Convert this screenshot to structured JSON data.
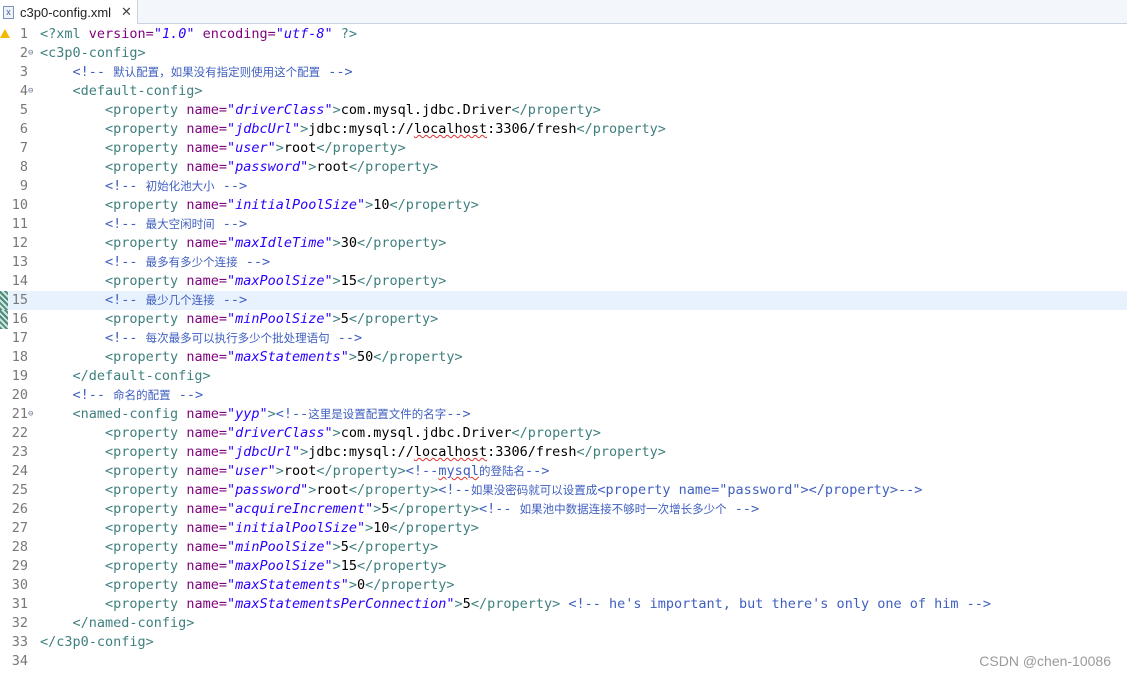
{
  "tab": {
    "title": "c3p0-config.xml",
    "close": "✕",
    "icon": "x"
  },
  "watermark": "CSDN @chen-10086",
  "lines": [
    {
      "n": "1",
      "warn": true,
      "segs": [
        [
          "t",
          "<?xml "
        ],
        [
          "a",
          "version="
        ],
        [
          "v",
          "\"1.0\""
        ],
        [
          "a",
          " encoding="
        ],
        [
          "v",
          "\"utf-8\""
        ],
        [
          "t",
          " ?>"
        ]
      ]
    },
    {
      "n": "2",
      "fold": true,
      "segs": [
        [
          "t",
          "<c3p0-config>"
        ]
      ]
    },
    {
      "n": "3",
      "segs": [
        [
          "x",
          "    "
        ],
        [
          "c",
          "<!-- "
        ],
        [
          "cj",
          "默认配置，如果没有指定则使用这个配置"
        ],
        [
          "c",
          " -->"
        ]
      ]
    },
    {
      "n": "4",
      "fold": true,
      "segs": [
        [
          "x",
          "    "
        ],
        [
          "t",
          "<default-config>"
        ]
      ]
    },
    {
      "n": "5",
      "segs": [
        [
          "x",
          "        "
        ],
        [
          "t",
          "<property "
        ],
        [
          "a",
          "name="
        ],
        [
          "v",
          "\"driverClass\""
        ],
        [
          "t",
          ">"
        ],
        [
          "x",
          "com.mysql.jdbc.Driver"
        ],
        [
          "t",
          "</property>"
        ]
      ]
    },
    {
      "n": "6",
      "segs": [
        [
          "x",
          "        "
        ],
        [
          "t",
          "<property "
        ],
        [
          "a",
          "name="
        ],
        [
          "v",
          "\"jdbcUrl\""
        ],
        [
          "t",
          ">"
        ],
        [
          "x",
          "jdbc:mysql://"
        ],
        [
          "xu",
          "localhost"
        ],
        [
          "x",
          ":3306/fresh"
        ],
        [
          "t",
          "</property>"
        ]
      ]
    },
    {
      "n": "7",
      "segs": [
        [
          "x",
          "        "
        ],
        [
          "t",
          "<property "
        ],
        [
          "a",
          "name="
        ],
        [
          "v",
          "\"user\""
        ],
        [
          "t",
          ">"
        ],
        [
          "x",
          "root"
        ],
        [
          "t",
          "</property>"
        ]
      ]
    },
    {
      "n": "8",
      "segs": [
        [
          "x",
          "        "
        ],
        [
          "t",
          "<property "
        ],
        [
          "a",
          "name="
        ],
        [
          "v",
          "\"password\""
        ],
        [
          "t",
          ">"
        ],
        [
          "x",
          "root"
        ],
        [
          "t",
          "</property>"
        ]
      ]
    },
    {
      "n": "9",
      "segs": [
        [
          "x",
          "        "
        ],
        [
          "c",
          "<!-- "
        ],
        [
          "cj",
          "初始化池大小"
        ],
        [
          "c",
          " -->"
        ]
      ]
    },
    {
      "n": "10",
      "segs": [
        [
          "x",
          "        "
        ],
        [
          "t",
          "<property "
        ],
        [
          "a",
          "name="
        ],
        [
          "v",
          "\"initialPoolSize\""
        ],
        [
          "t",
          ">"
        ],
        [
          "x",
          "10"
        ],
        [
          "t",
          "</property>"
        ]
      ]
    },
    {
      "n": "11",
      "segs": [
        [
          "x",
          "        "
        ],
        [
          "c",
          "<!-- "
        ],
        [
          "cj",
          "最大空闲时间"
        ],
        [
          "c",
          " -->"
        ]
      ]
    },
    {
      "n": "12",
      "segs": [
        [
          "x",
          "        "
        ],
        [
          "t",
          "<property "
        ],
        [
          "a",
          "name="
        ],
        [
          "v",
          "\"maxIdleTime\""
        ],
        [
          "t",
          ">"
        ],
        [
          "x",
          "30"
        ],
        [
          "t",
          "</property>"
        ]
      ]
    },
    {
      "n": "13",
      "segs": [
        [
          "x",
          "        "
        ],
        [
          "c",
          "<!-- "
        ],
        [
          "cj",
          "最多有多少个连接"
        ],
        [
          "c",
          " -->"
        ]
      ]
    },
    {
      "n": "14",
      "segs": [
        [
          "x",
          "        "
        ],
        [
          "t",
          "<property "
        ],
        [
          "a",
          "name="
        ],
        [
          "v",
          "\"maxPoolSize\""
        ],
        [
          "t",
          ">"
        ],
        [
          "x",
          "15"
        ],
        [
          "t",
          "</property>"
        ]
      ]
    },
    {
      "n": "15",
      "current": true,
      "changed": true,
      "segs": [
        [
          "x",
          "        "
        ],
        [
          "c",
          "<!-- "
        ],
        [
          "cj",
          "最少几个连接"
        ],
        [
          "c",
          " -->"
        ]
      ]
    },
    {
      "n": "16",
      "changed": true,
      "segs": [
        [
          "x",
          "        "
        ],
        [
          "t",
          "<property "
        ],
        [
          "a",
          "name="
        ],
        [
          "v",
          "\"minPoolSize\""
        ],
        [
          "t",
          ">"
        ],
        [
          "x",
          "5"
        ],
        [
          "t",
          "</property>"
        ]
      ]
    },
    {
      "n": "17",
      "segs": [
        [
          "x",
          "        "
        ],
        [
          "c",
          "<!-- "
        ],
        [
          "cj",
          "每次最多可以执行多少个批处理语句"
        ],
        [
          "c",
          " -->"
        ]
      ]
    },
    {
      "n": "18",
      "segs": [
        [
          "x",
          "        "
        ],
        [
          "t",
          "<property "
        ],
        [
          "a",
          "name="
        ],
        [
          "v",
          "\"maxStatements\""
        ],
        [
          "t",
          ">"
        ],
        [
          "x",
          "50"
        ],
        [
          "t",
          "</property>"
        ]
      ]
    },
    {
      "n": "19",
      "segs": [
        [
          "x",
          "    "
        ],
        [
          "t",
          "</default-config>"
        ]
      ]
    },
    {
      "n": "20",
      "segs": [
        [
          "x",
          "    "
        ],
        [
          "c",
          "<!-- "
        ],
        [
          "cj",
          "命名的配置"
        ],
        [
          "c",
          " -->"
        ]
      ]
    },
    {
      "n": "21",
      "fold": true,
      "segs": [
        [
          "x",
          "    "
        ],
        [
          "t",
          "<named-config "
        ],
        [
          "a",
          "name="
        ],
        [
          "v",
          "\"yyp\""
        ],
        [
          "t",
          ">"
        ],
        [
          "c",
          "<!--"
        ],
        [
          "cj",
          "这里是设置配置文件的名字"
        ],
        [
          "c",
          "-->"
        ]
      ]
    },
    {
      "n": "22",
      "segs": [
        [
          "x",
          "        "
        ],
        [
          "t",
          "<property "
        ],
        [
          "a",
          "name="
        ],
        [
          "v",
          "\"driverClass\""
        ],
        [
          "t",
          ">"
        ],
        [
          "x",
          "com.mysql.jdbc.Driver"
        ],
        [
          "t",
          "</property>"
        ]
      ]
    },
    {
      "n": "23",
      "segs": [
        [
          "x",
          "        "
        ],
        [
          "t",
          "<property "
        ],
        [
          "a",
          "name="
        ],
        [
          "v",
          "\"jdbcUrl\""
        ],
        [
          "t",
          ">"
        ],
        [
          "x",
          "jdbc:mysql://"
        ],
        [
          "xu",
          "localhost"
        ],
        [
          "x",
          ":3306/fresh"
        ],
        [
          "t",
          "</property>"
        ]
      ]
    },
    {
      "n": "24",
      "segs": [
        [
          "x",
          "        "
        ],
        [
          "t",
          "<property "
        ],
        [
          "a",
          "name="
        ],
        [
          "v",
          "\"user\""
        ],
        [
          "t",
          ">"
        ],
        [
          "x",
          "root"
        ],
        [
          "t",
          "</property>"
        ],
        [
          "c",
          "<!--"
        ],
        [
          "cu",
          "mysql"
        ],
        [
          "cj",
          "的登陆名"
        ],
        [
          "c",
          "-->"
        ]
      ]
    },
    {
      "n": "25",
      "segs": [
        [
          "x",
          "        "
        ],
        [
          "t",
          "<property "
        ],
        [
          "a",
          "name="
        ],
        [
          "v",
          "\"password\""
        ],
        [
          "t",
          ">"
        ],
        [
          "x",
          "root"
        ],
        [
          "t",
          "</property>"
        ],
        [
          "c",
          "<!--"
        ],
        [
          "cj",
          "如果没密码就可以设置成"
        ],
        [
          "c",
          "<property name=\"password\"></property>-->"
        ]
      ]
    },
    {
      "n": "26",
      "segs": [
        [
          "x",
          "        "
        ],
        [
          "t",
          "<property "
        ],
        [
          "a",
          "name="
        ],
        [
          "v",
          "\"acquireIncrement\""
        ],
        [
          "t",
          ">"
        ],
        [
          "x",
          "5"
        ],
        [
          "t",
          "</property>"
        ],
        [
          "c",
          "<!-- "
        ],
        [
          "cj",
          "如果池中数据连接不够时一次增长多少个"
        ],
        [
          "c",
          " -->"
        ]
      ]
    },
    {
      "n": "27",
      "segs": [
        [
          "x",
          "        "
        ],
        [
          "t",
          "<property "
        ],
        [
          "a",
          "name="
        ],
        [
          "v",
          "\"initialPoolSize\""
        ],
        [
          "t",
          ">"
        ],
        [
          "x",
          "10"
        ],
        [
          "t",
          "</property>"
        ]
      ]
    },
    {
      "n": "28",
      "segs": [
        [
          "x",
          "        "
        ],
        [
          "t",
          "<property "
        ],
        [
          "a",
          "name="
        ],
        [
          "v",
          "\"minPoolSize\""
        ],
        [
          "t",
          ">"
        ],
        [
          "x",
          "5"
        ],
        [
          "t",
          "</property>"
        ]
      ]
    },
    {
      "n": "29",
      "segs": [
        [
          "x",
          "        "
        ],
        [
          "t",
          "<property "
        ],
        [
          "a",
          "name="
        ],
        [
          "v",
          "\"maxPoolSize\""
        ],
        [
          "t",
          ">"
        ],
        [
          "x",
          "15"
        ],
        [
          "t",
          "</property>"
        ]
      ]
    },
    {
      "n": "30",
      "segs": [
        [
          "x",
          "        "
        ],
        [
          "t",
          "<property "
        ],
        [
          "a",
          "name="
        ],
        [
          "v",
          "\"maxStatements\""
        ],
        [
          "t",
          ">"
        ],
        [
          "x",
          "0"
        ],
        [
          "t",
          "</property>"
        ]
      ]
    },
    {
      "n": "31",
      "segs": [
        [
          "x",
          "        "
        ],
        [
          "t",
          "<property "
        ],
        [
          "a",
          "name="
        ],
        [
          "v",
          "\"maxStatementsPerConnection\""
        ],
        [
          "t",
          ">"
        ],
        [
          "x",
          "5"
        ],
        [
          "t",
          "</property>"
        ],
        [
          "c",
          " <!-- he's important, but there's only one of him -->"
        ]
      ]
    },
    {
      "n": "32",
      "segs": [
        [
          "x",
          "    "
        ],
        [
          "t",
          "</named-config>"
        ]
      ]
    },
    {
      "n": "33",
      "segs": [
        [
          "t",
          "</c3p0-config>"
        ]
      ]
    },
    {
      "n": "34",
      "segs": []
    }
  ]
}
